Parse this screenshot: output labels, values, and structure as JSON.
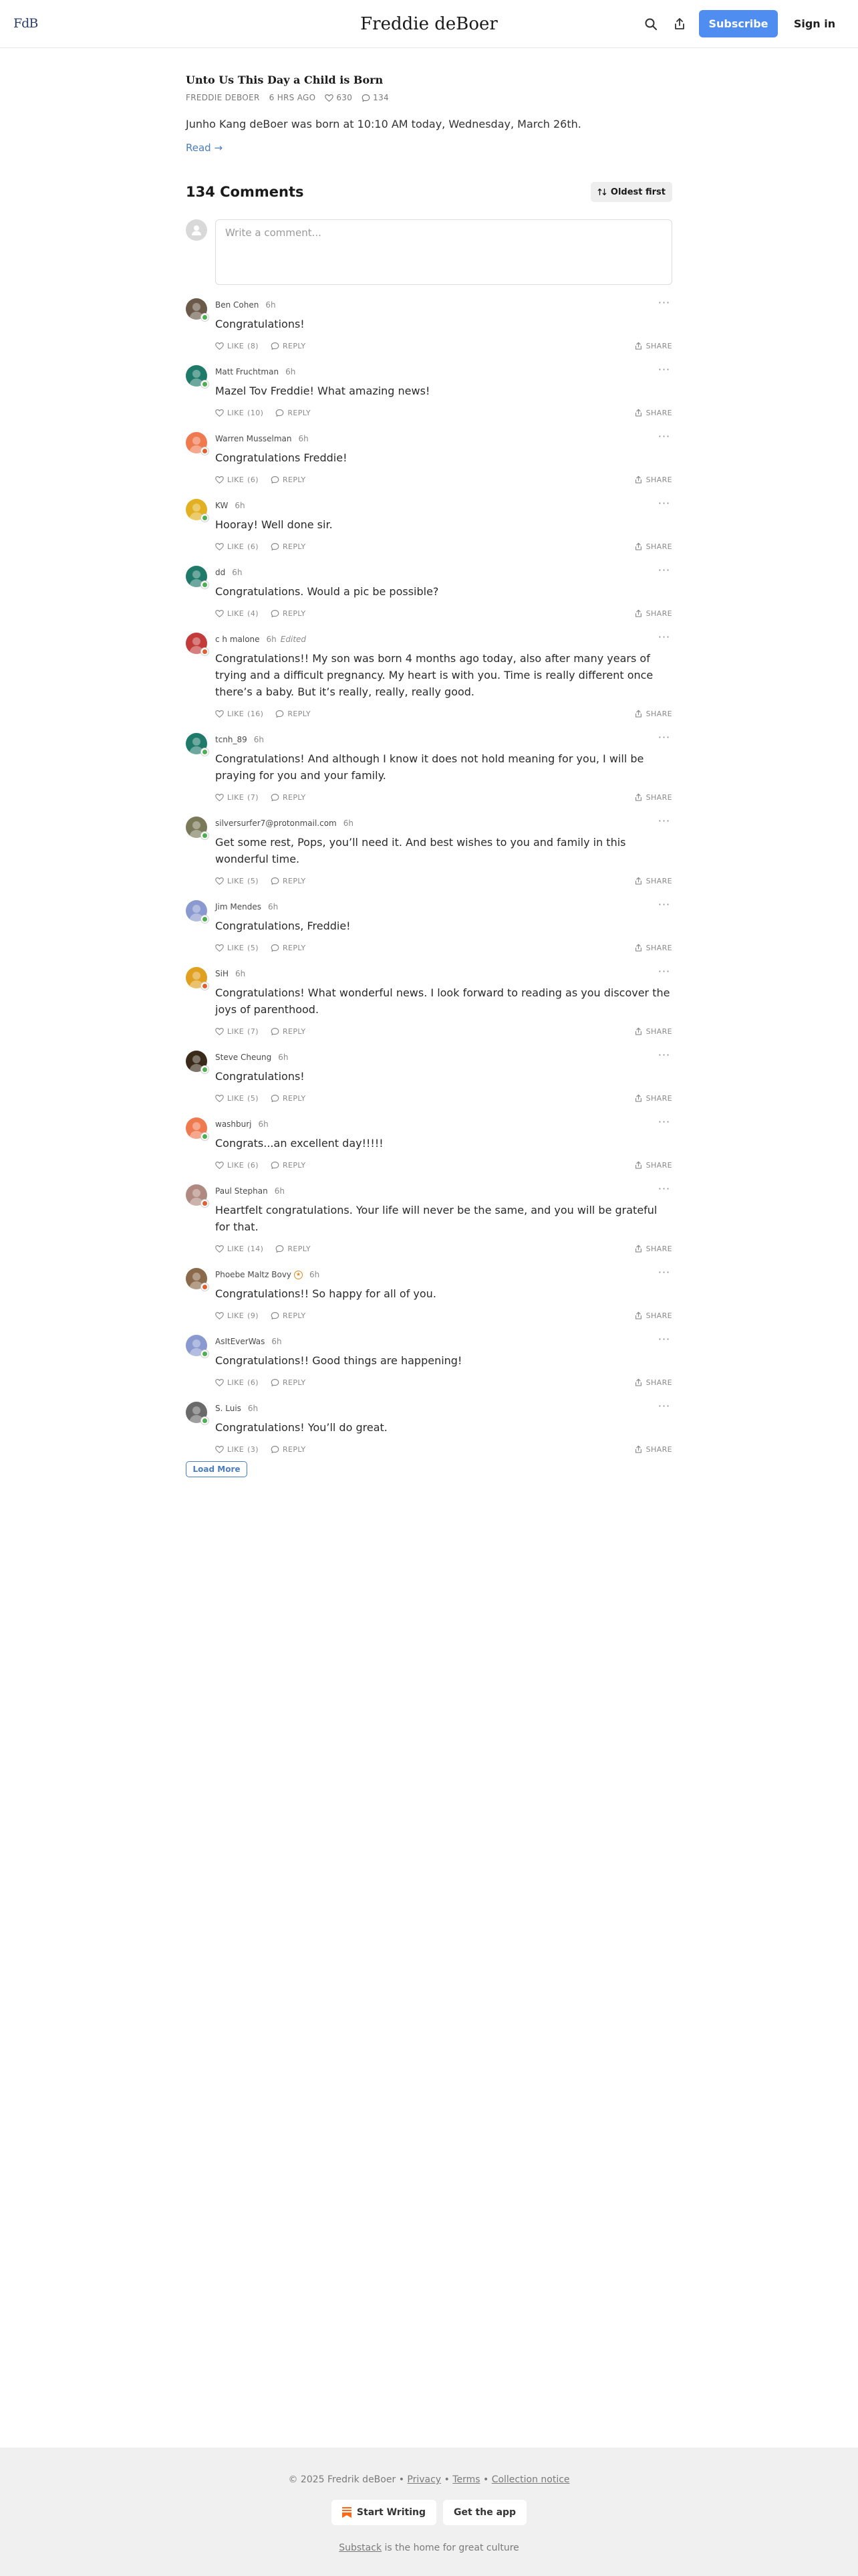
{
  "header": {
    "logo_text": "FdB",
    "publication_title": "Freddie deBoer",
    "subscribe_label": "Subscribe",
    "signin_label": "Sign in"
  },
  "post": {
    "title": "Unto Us This Day a Child is Born",
    "author": "FREDDIE DEBOER",
    "age": "6 HRS AGO",
    "likes": "630",
    "comments": "134",
    "body": "Junho Kang deBoer was born at 10:10 AM today, Wednesday, March 26th.",
    "read_label": "Read →"
  },
  "comments_section": {
    "count_label": "134 Comments",
    "sort_label": "Oldest first",
    "composer_placeholder": "Write a comment...",
    "like_word": "LIKE",
    "reply_label": "REPLY",
    "share_label": "SHARE",
    "load_more_label": "Load More"
  },
  "comments": [
    {
      "name": "Ben Cohen",
      "time": "6h",
      "edited": "",
      "text": "Congratulations!",
      "likes": "(8)",
      "avatar_color": "#6b5a4a",
      "badge_color": "#4caf50"
    },
    {
      "name": "Matt Fruchtman",
      "time": "6h",
      "edited": "",
      "text": "Mazel Tov Freddie! What amazing news!",
      "likes": "(10)",
      "avatar_color": "#1f7a6a",
      "badge_color": "#4caf50"
    },
    {
      "name": "Warren Musselman",
      "time": "6h",
      "edited": "",
      "text": "Congratulations Freddie!",
      "likes": "(6)",
      "avatar_color": "#f07a50",
      "badge_color": "#e06030"
    },
    {
      "name": "KW",
      "time": "6h",
      "edited": "",
      "text": "Hooray! Well done sir.",
      "likes": "(6)",
      "avatar_color": "#e2b020",
      "badge_color": "#4caf50"
    },
    {
      "name": "dd",
      "time": "6h",
      "edited": "",
      "text": "Congratulations. Would a pic be possible?",
      "likes": "(4)",
      "avatar_color": "#1f7a6a",
      "badge_color": "#4caf50"
    },
    {
      "name": "c h malone",
      "time": "6h",
      "edited": "Edited",
      "text": "Congratulations!! My son was born 4 months ago today, also after many years of trying and a difficult pregnancy. My heart is with you. Time is really different once there’s a baby. But it’s really, really, really good.",
      "likes": "(16)",
      "avatar_color": "#c23a3a",
      "badge_color": "#e06030"
    },
    {
      "name": "tcnh_89",
      "time": "6h",
      "edited": "",
      "text": "Congratulations! And although I know it does not hold meaning for you, I will be praying for you and your family.",
      "likes": "(7)",
      "avatar_color": "#1f7a6a",
      "badge_color": "#4caf50"
    },
    {
      "name": "silversurfer7@protonmail.com",
      "time": "6h",
      "edited": "",
      "text": "Get some rest, Pops, you’ll need it. And best wishes to you and family in this wonderful time.",
      "likes": "(5)",
      "avatar_color": "#7a7a5a",
      "badge_color": "#4caf50"
    },
    {
      "name": "Jim Mendes",
      "time": "6h",
      "edited": "",
      "text": "Congratulations, Freddie!",
      "likes": "(5)",
      "avatar_color": "#8a9ad0",
      "badge_color": "#4caf50"
    },
    {
      "name": "SiH",
      "time": "6h",
      "edited": "",
      "text": "Congratulations! What wonderful news. I look forward to reading as you discover the joys of parenthood.",
      "likes": "(7)",
      "avatar_color": "#e0a020",
      "badge_color": "#e06030"
    },
    {
      "name": "Steve Cheung",
      "time": "6h",
      "edited": "",
      "text": "Congratulations!",
      "likes": "(5)",
      "avatar_color": "#3a2a1a",
      "badge_color": "#4caf50"
    },
    {
      "name": "washburj",
      "time": "6h",
      "edited": "",
      "text": "Congrats...an excellent day!!!!!",
      "likes": "(6)",
      "avatar_color": "#f07a50",
      "badge_color": "#4caf50"
    },
    {
      "name": "Paul Stephan",
      "time": "6h",
      "edited": "",
      "text": "Heartfelt congratulations. Your life will never be the same, and you will be grateful for that.",
      "likes": "(14)",
      "avatar_color": "#b08a80",
      "badge_color": "#e06030"
    },
    {
      "name": "Phoebe Maltz Bovy",
      "time": "6h",
      "edited": "",
      "text": "Congratulations!! So happy for all of you.",
      "likes": "(9)",
      "avatar_color": "#8a6a4a",
      "badge_color": "#e06030",
      "bestseller": true
    },
    {
      "name": "AsItEverWas",
      "time": "6h",
      "edited": "",
      "text": "Congratulations!! Good things are happening!",
      "likes": "(6)",
      "avatar_color": "#8a9ad0",
      "badge_color": "#4caf50"
    },
    {
      "name": "S. Luis",
      "time": "6h",
      "edited": "",
      "text": "Congratulations! You’ll do great.",
      "likes": "(3)",
      "avatar_color": "#6a6a6a",
      "badge_color": "#4caf50"
    }
  ],
  "footer": {
    "copyright": "© 2025 Fredrik deBoer",
    "separator": "•",
    "privacy_label": "Privacy",
    "terms_label": "Terms",
    "collection_label": "Collection notice",
    "start_writing_label": "Start Writing",
    "get_app_label": "Get the app",
    "tagline_link": "Substack",
    "tagline_rest": " is the home for great culture"
  },
  "colors": {
    "accent": "#4f8ef0",
    "link": "#4a7ec0",
    "footer_bg": "#f0f0f0"
  },
  "icons": {
    "search": "search-icon",
    "share_top": "share-icon",
    "heart": "heart-icon",
    "comment": "comment-icon",
    "sort": "sort-arrows-icon",
    "more": "more-dots-icon",
    "substack": "substack-icon"
  }
}
